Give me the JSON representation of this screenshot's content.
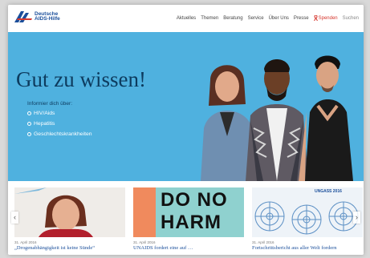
{
  "logo": {
    "line1": "Deutsche",
    "line2": "AIDS-Hilfe"
  },
  "nav": {
    "items": [
      "Aktuelles",
      "Themen",
      "Beratung",
      "Service",
      "Über Uns",
      "Presse"
    ],
    "spenden": "Spenden",
    "search": "Suchen"
  },
  "hero": {
    "title": "Gut zu wissen!",
    "subtitle": "Informier dich über:",
    "links": [
      "HIV/Aids",
      "Hepatitis",
      "Geschlechtskrankheiten"
    ]
  },
  "cards": [
    {
      "date": "31. April 2016",
      "title": "„Drogenabhängigkeit ist keine Sünde“"
    },
    {
      "date": "31. April 2016",
      "title": "UNAIDS fordert eine auf …",
      "image_text_1": "DO NO",
      "image_text_2": "HARM"
    },
    {
      "date": "31. April 2016",
      "title": "Fortschrittsbericht aus aller Welt fordern",
      "image_header": "UNGASS 2016"
    }
  ],
  "colors": {
    "brand": "#1b4f9b",
    "hero_bg": "#4fb1df",
    "spenden": "#d6382f"
  }
}
